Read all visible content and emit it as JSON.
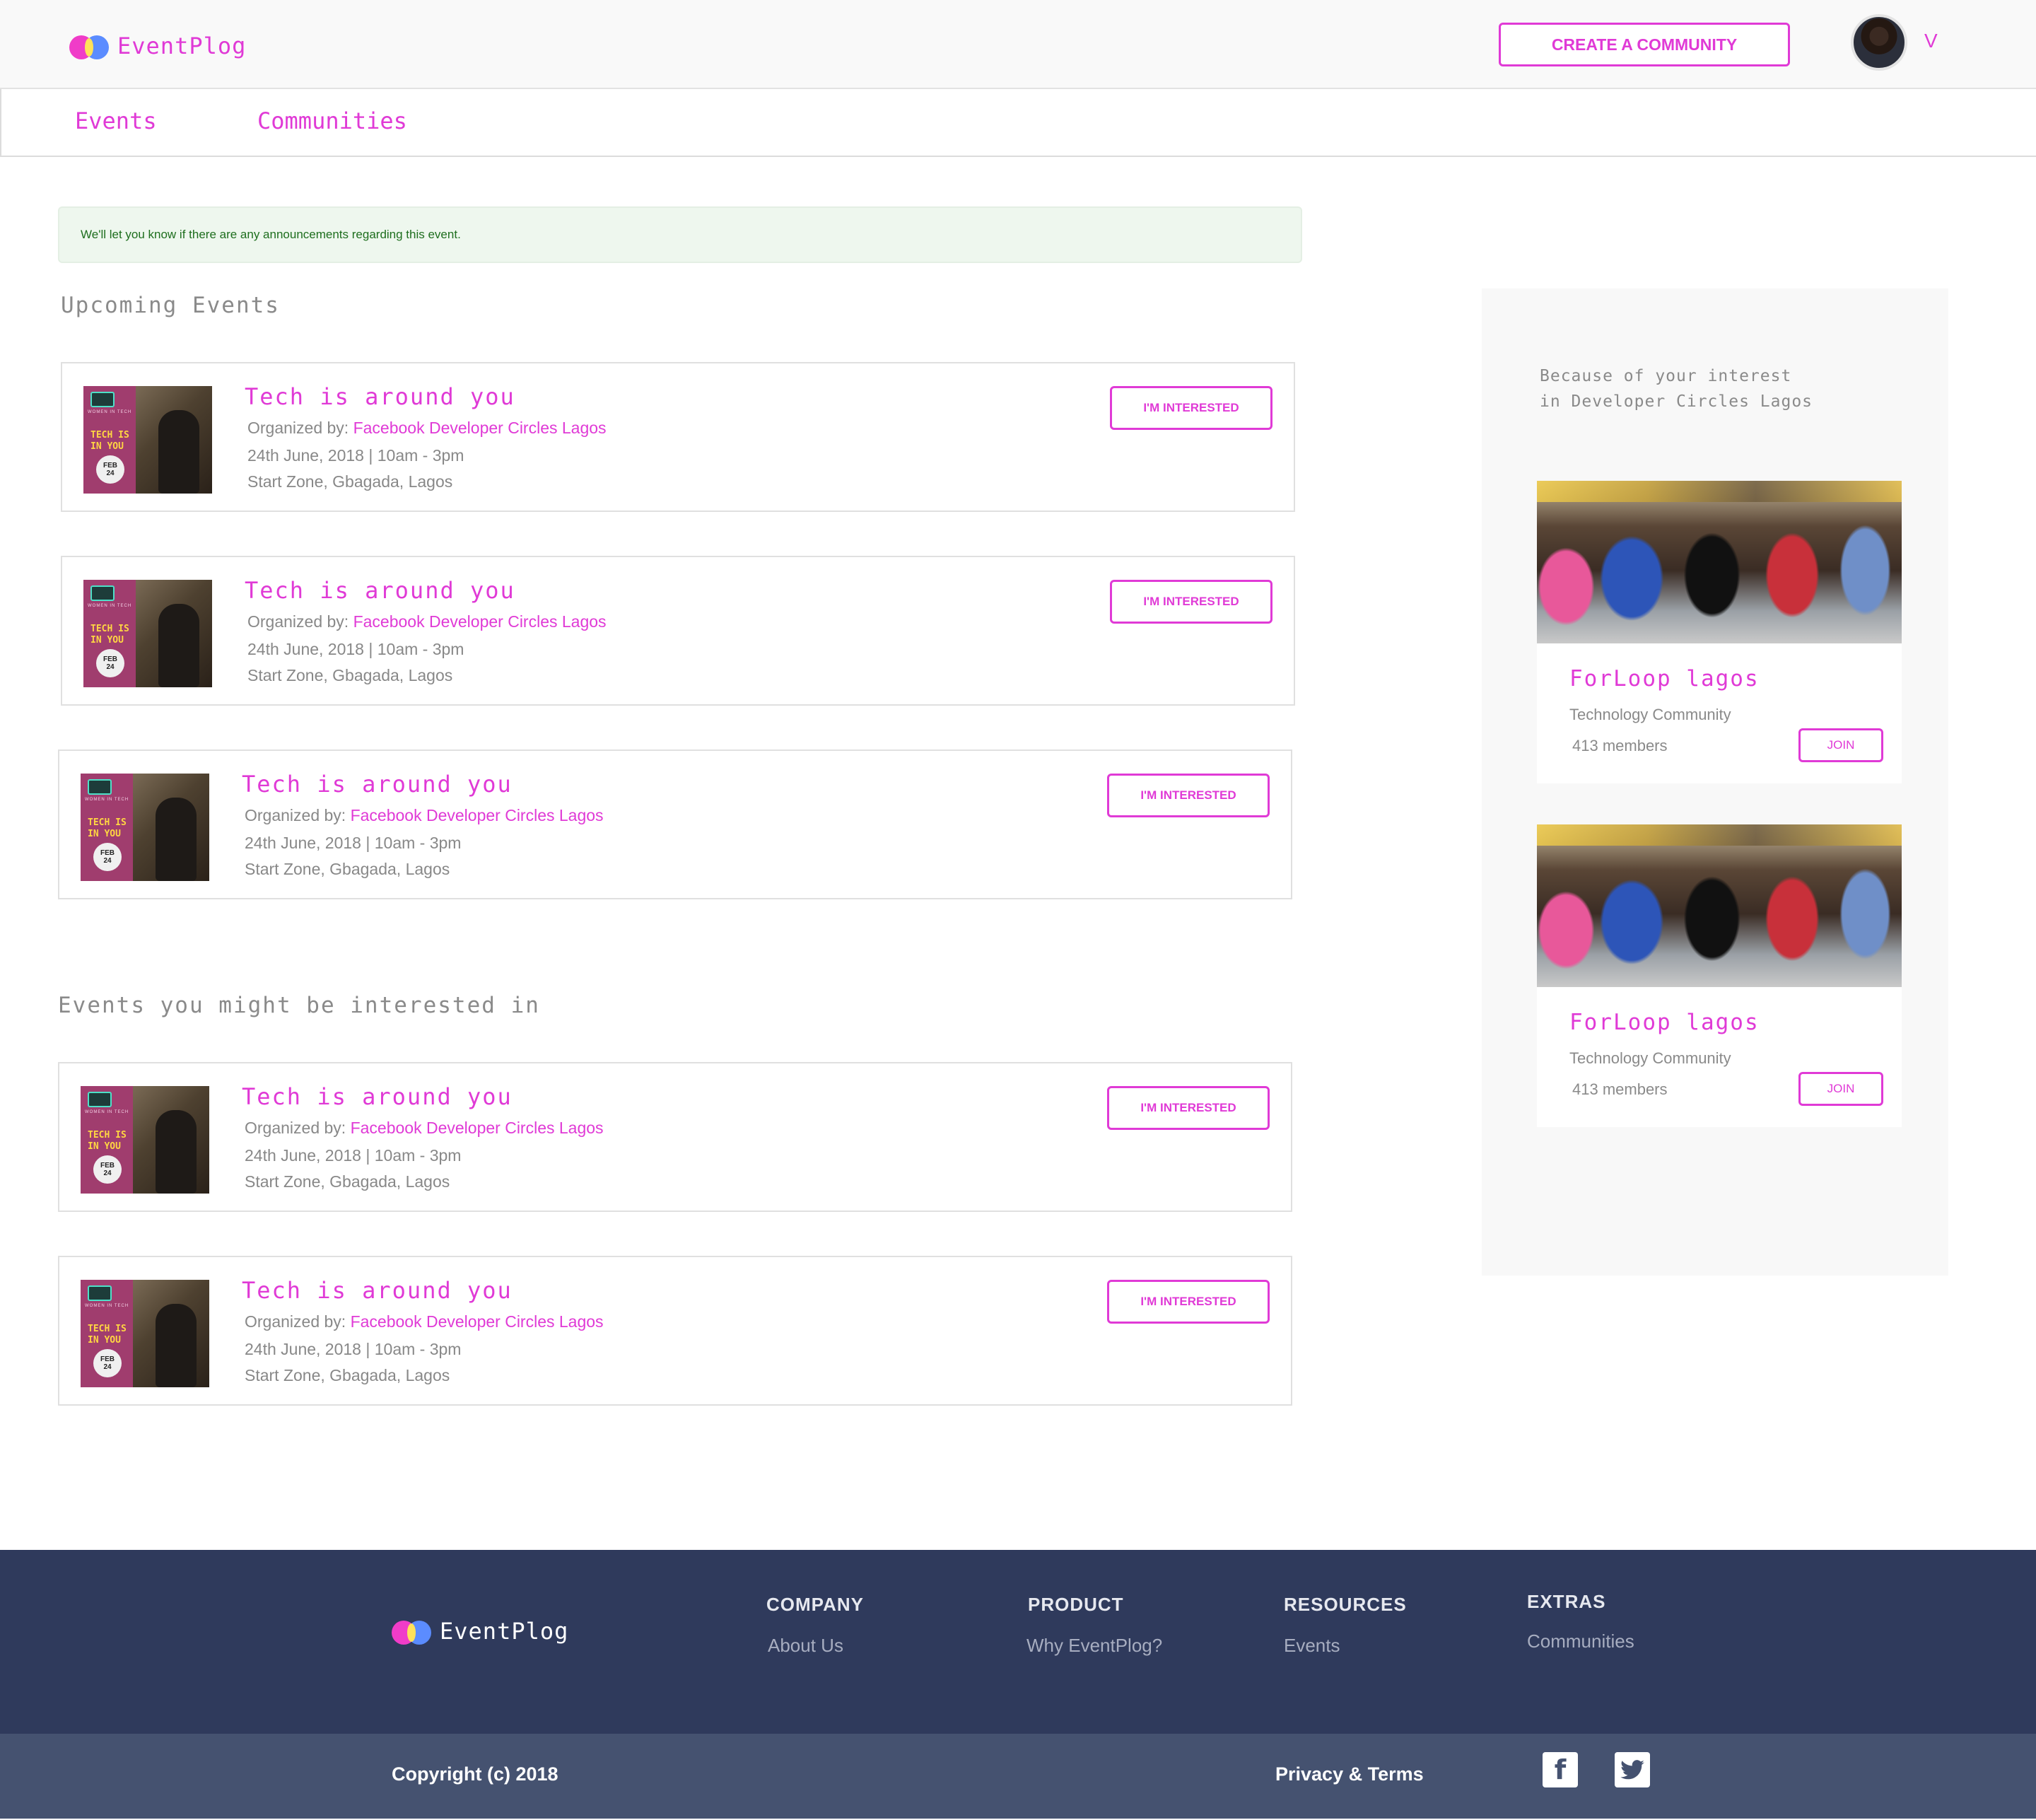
{
  "brand": {
    "name": "EventPlog"
  },
  "header": {
    "create_label": "CREATE A COMMUNITY",
    "user_initial": "V"
  },
  "nav": {
    "tabs": [
      {
        "label": "Events"
      },
      {
        "label": "Communities"
      }
    ]
  },
  "notice": {
    "text": "We'll let you know if there are any announcements regarding this event."
  },
  "upcoming": {
    "title": "Upcoming Events",
    "events": [
      {
        "title": "Tech is around you",
        "organized_by": "Organized by: ",
        "organizer": "Facebook Developer Circles Lagos",
        "datetime": "24th June, 2018 | 10am - 3pm",
        "location": "Start Zone, Gbagada, Lagos",
        "button": "I'M INTERESTED"
      },
      {
        "title": "Tech is around you",
        "organized_by": "Organized by: ",
        "organizer": "Facebook Developer Circles Lagos",
        "datetime": "24th June, 2018 | 10am - 3pm",
        "location": "Start Zone, Gbagada, Lagos",
        "button": "I'M INTERESTED"
      },
      {
        "title": "Tech is around you",
        "organized_by": "Organized by: ",
        "organizer": "Facebook Developer Circles Lagos",
        "datetime": "24th June, 2018 | 10am - 3pm",
        "location": "Start Zone, Gbagada, Lagos",
        "button": "I'M INTERESTED"
      }
    ]
  },
  "suggested": {
    "title": "Events you might be interested in",
    "events": [
      {
        "title": "Tech is around you",
        "organized_by": "Organized by: ",
        "organizer": "Facebook Developer Circles Lagos",
        "datetime": "24th June, 2018 | 10am - 3pm",
        "location": "Start Zone, Gbagada, Lagos",
        "button": "I'M INTERESTED"
      },
      {
        "title": "Tech is around you",
        "organized_by": "Organized by: ",
        "organizer": "Facebook Developer Circles Lagos",
        "datetime": "24th June, 2018 | 10am - 3pm",
        "location": "Start Zone, Gbagada, Lagos",
        "button": "I'M INTERESTED"
      }
    ]
  },
  "poster": {
    "header": "WOMEN IN TECH",
    "line1": "TECH IS",
    "line2": "IN YOU",
    "month": "FEB",
    "day": "24"
  },
  "sidebar": {
    "intro_line1": "Because of your interest",
    "intro_line2": "in Developer Circles Lagos",
    "communities": [
      {
        "name": "ForLoop lagos",
        "type": "Technology Community",
        "members": "413 members",
        "button": "JOIN"
      },
      {
        "name": "ForLoop lagos",
        "type": "Technology Community",
        "members": "413 members",
        "button": "JOIN"
      }
    ]
  },
  "footer": {
    "columns": [
      {
        "heading": "COMPANY",
        "link": "About Us"
      },
      {
        "heading": "PRODUCT",
        "link": "Why EventPlog?"
      },
      {
        "heading": "RESOURCES",
        "link": "Events"
      },
      {
        "heading": "EXTRAS",
        "link": "Communities"
      }
    ],
    "copyright": "Copyright (c) 2018",
    "privacy": "Privacy & Terms",
    "social_icons": [
      "facebook-icon",
      "twitter-icon"
    ]
  },
  "colors": {
    "accent": "#e03ad6",
    "footer_bg": "#2f3a5c",
    "subfooter_bg": "#455270",
    "notice_bg": "#eef7ee",
    "notice_text": "#1e6e1e"
  }
}
